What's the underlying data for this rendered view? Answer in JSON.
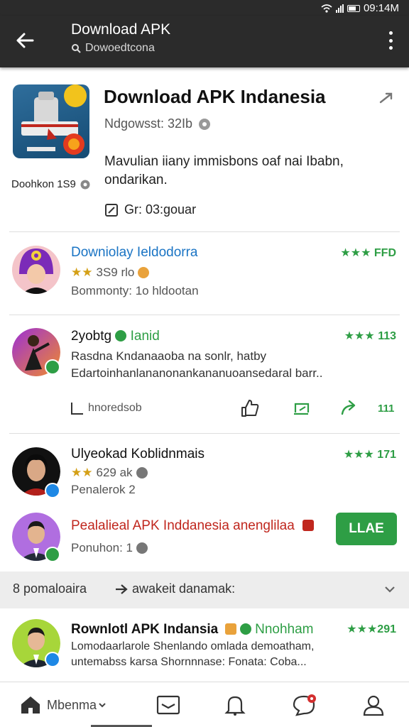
{
  "status_bar": {
    "time": "09:14M"
  },
  "app_bar": {
    "title": "Download APK",
    "subtitle": "Dowoedtcona"
  },
  "app": {
    "title": "Download APK Indanesia",
    "downloads": "Ndgowsst: 32Ib",
    "description_line1": "Mavulian iiany immisbons oaf nai Ibabn,",
    "description_line2": "ondarikan.",
    "download_count": "Doohkon 1S9",
    "size": "Gr: 03:gouar"
  },
  "reviews": [
    {
      "name": "Downiolay Ieldodorra",
      "stars": "★★",
      "meta": "3S9 rlo",
      "sub": "Bommonty: 1o hldootan",
      "rating": "FFD"
    },
    {
      "name": "2yobtg",
      "tag": "Ianid",
      "line1": "Rasdna Kndanaaoba na sonlr, hatby",
      "line2": "Edartoinhanlananonankananuoansedaral barr..",
      "rating": "113"
    },
    {
      "name": "Ulyeokad Koblidnmais",
      "stars": "★★",
      "meta": "629 ak",
      "sub": "Penalerok 2",
      "rating": "171"
    },
    {
      "name": "Pealalieal APK Inddanesia anenglilaa",
      "sub": "Ponuhon: 1"
    },
    {
      "name": "Rownlotl APK Indansia",
      "tag": "Nnohham",
      "line1": "Lomodaarlarole Shenlando omlada demoatham,",
      "line2": "untemabss karsa Shornnnase: Fonata: Coba...",
      "rating": "291"
    }
  ],
  "actions": {
    "reply_label": "hnoredsob",
    "count": "111"
  },
  "install_button": "LLAE",
  "section": {
    "left": "8 pomaloaira",
    "mid": "awakeit danamak:"
  },
  "bottom_nav": {
    "home_label": "Mbenma"
  },
  "colors": {
    "app_bar": "#2b2b2b",
    "accent_green": "#2e9e45",
    "link_blue": "#1a74c4",
    "danger_red": "#c0271e"
  }
}
